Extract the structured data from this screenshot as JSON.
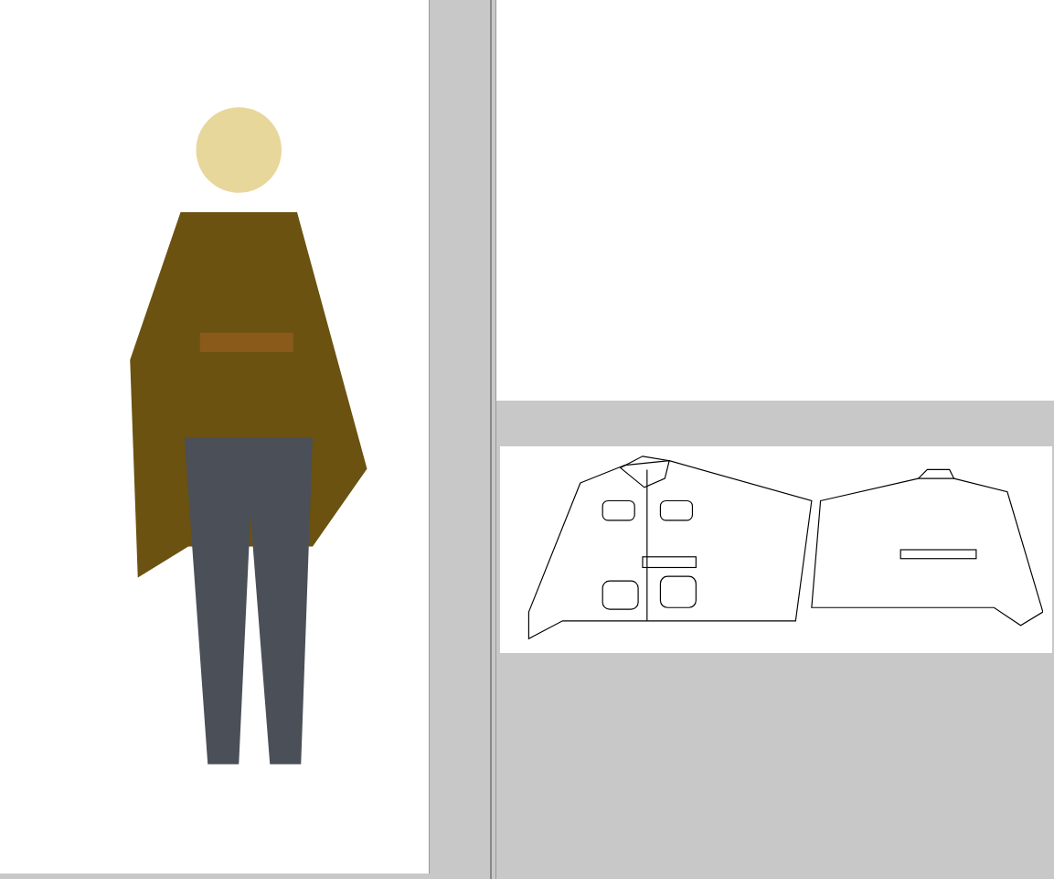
{
  "panels": [
    {
      "kind": "illustration"
    },
    {
      "kind": "blank"
    },
    {
      "kind": "flat-sketch"
    }
  ]
}
